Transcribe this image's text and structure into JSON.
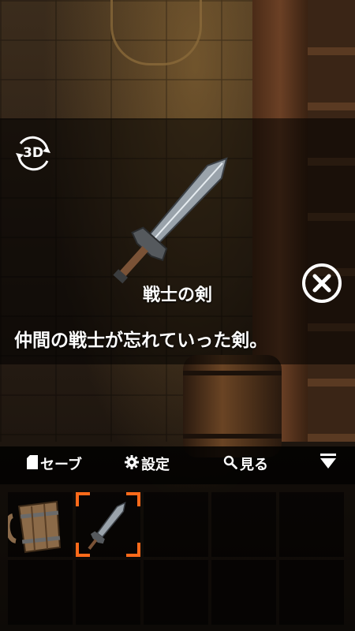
{
  "item_view": {
    "rotate_label": "3D",
    "name": "戦士の剣",
    "description": "仲間の戦士が忘れていった剣。"
  },
  "menu": {
    "save_label": "セーブ",
    "settings_label": "設定",
    "look_label": "見る"
  },
  "inventory": {
    "slots": [
      {
        "icon": "mug-icon"
      },
      {
        "icon": "sword-icon",
        "selected": true
      },
      {
        "icon": ""
      },
      {
        "icon": ""
      },
      {
        "icon": ""
      },
      {
        "icon": ""
      },
      {
        "icon": ""
      },
      {
        "icon": ""
      },
      {
        "icon": ""
      },
      {
        "icon": ""
      }
    ]
  },
  "colors": {
    "selection_accent": "#ff6a1a",
    "overlay": "#000000",
    "text": "#ffffff"
  }
}
